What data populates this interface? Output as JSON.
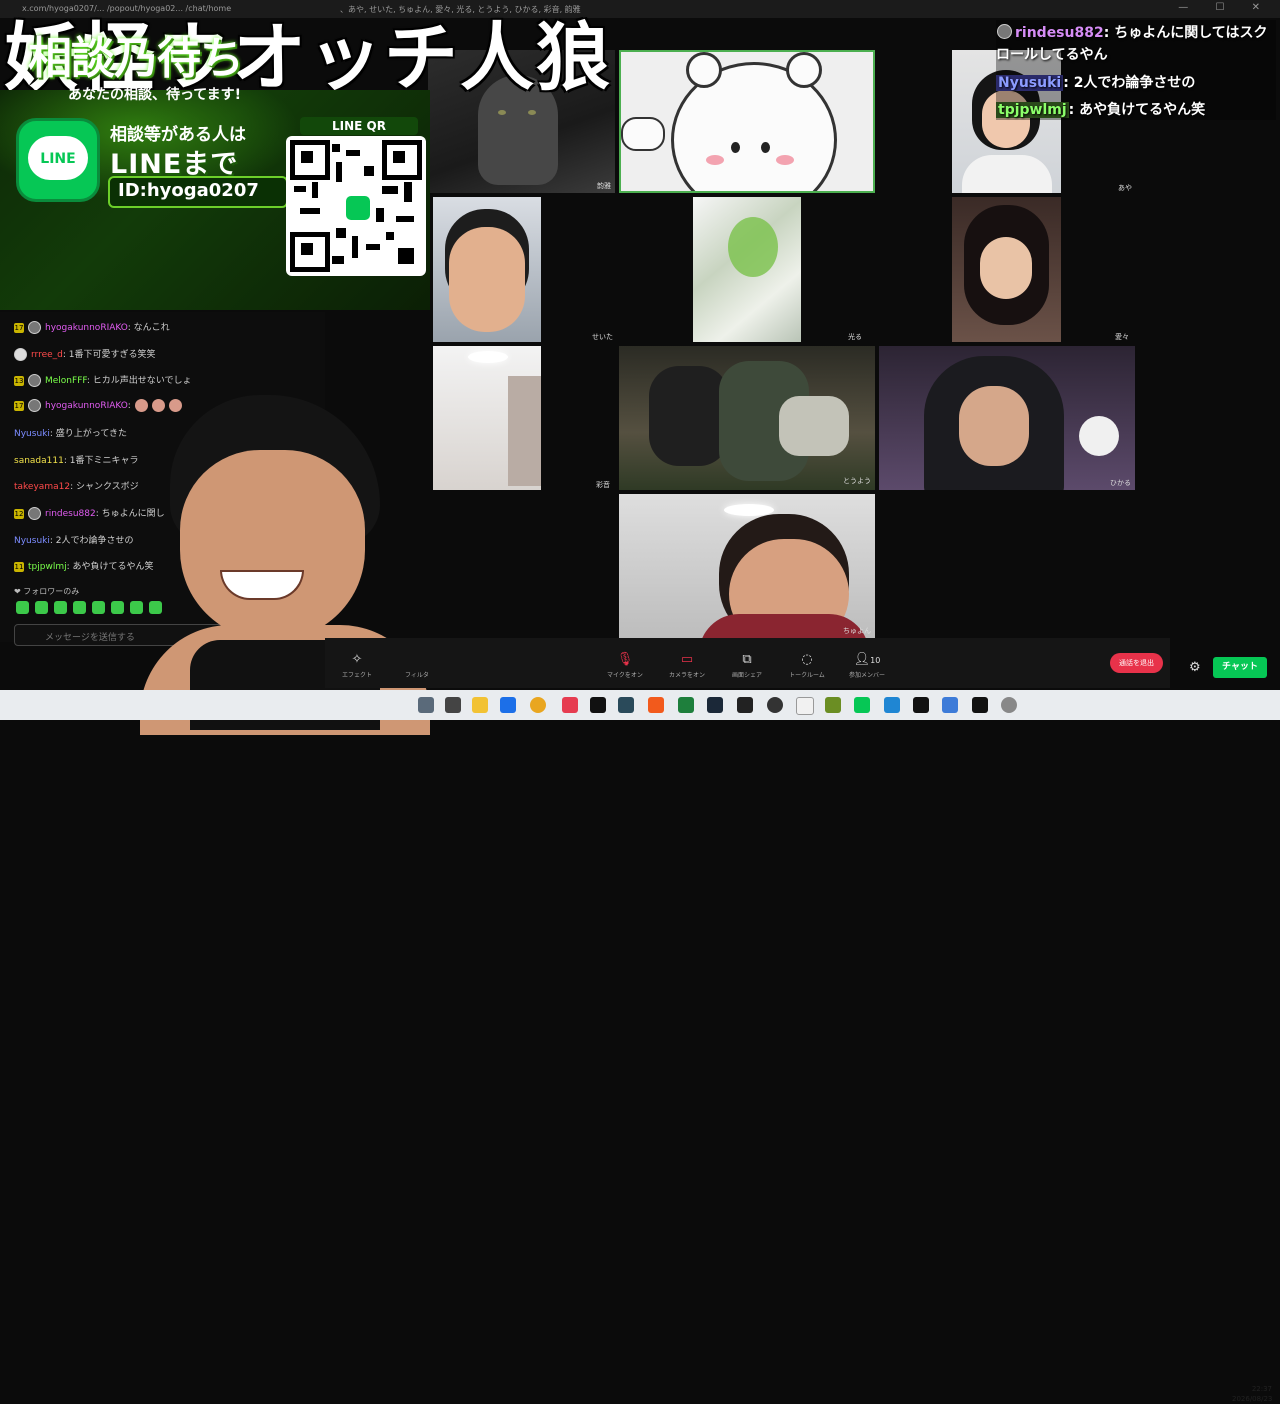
{
  "titlebar": {
    "url": "x.com/hyoga0207/... /popout/hyoga02... /chat/home",
    "participants": "、あや, せいた, ちゅよん, 愛々, 光る, とうよう, ひかる, 彩音, 韵雅",
    "window_controls": "— ☐ ✕"
  },
  "overlay_title": "妖怪ウオッチ人狼",
  "banner": {
    "title": "相談乃待ち",
    "subtitle": "あなたの相談、待ってます!",
    "line_icon_text": "LINE",
    "line_line1": "相談等がある人は",
    "line_line2": "LINEまで",
    "line_id": "ID:hyoga0207",
    "qr_label": "LINE QR"
  },
  "stream_chat": {
    "messages": [
      {
        "badge": "17",
        "user": "hyogakunnoRIAKO",
        "text": ": なんこれ",
        "user_color": "pink",
        "emotes": 0
      },
      {
        "badge": "",
        "user": "rrree_d",
        "text": ": 1番下可愛すぎる笑笑",
        "user_color": "red",
        "emotes": 0
      },
      {
        "badge": "13",
        "user": "MelonFFF",
        "text": ": ヒカル声出せないでしょ",
        "user_color": "green",
        "emotes": 0
      },
      {
        "badge": "17",
        "user": "hyogakunnoRIAKO",
        "text": ":",
        "user_color": "pink",
        "emotes": 3
      },
      {
        "badge": "",
        "user": "Nyusuki",
        "text": ": 盛り上がってきた",
        "user_color": "blue",
        "emotes": 0
      },
      {
        "badge": "",
        "user": "sanada111",
        "text": ": 1番下ミニキャラ",
        "user_color": "yellow",
        "emotes": 0
      },
      {
        "badge": "",
        "user": "takeyama12",
        "text": ": シャンクスボジ",
        "user_color": "red",
        "emotes": 0
      },
      {
        "badge": "12",
        "user": "rindesu882",
        "text": ": ちゅよんに関し",
        "user_color": "pink",
        "emotes": 0
      },
      {
        "badge": "",
        "user": "Nyusuki",
        "text": ": 2人でわ論争させの",
        "user_color": "blue",
        "emotes": 0
      },
      {
        "badge": "11",
        "user": "tpjpwlmj",
        "text": ": あや負けてるやん笑",
        "user_color": "green",
        "emotes": 0
      }
    ],
    "follower_only": "❤ フォロワーのみ",
    "input_placeholder": "メッセージを送信する"
  },
  "right_chat": [
    {
      "user": "rindesu882",
      "text": ": ちゅよんに関してはスク",
      "continuation": "ロールしてるやん",
      "user_color": "#d58cf5"
    },
    {
      "user": "Nyusuki",
      "text": ": 2人でわ論争させの",
      "continuation": "",
      "user_color": "#8c9cff"
    },
    {
      "user": "tpjpwlmj",
      "text": ": あや負けてるやん笑",
      "continuation": "",
      "user_color": "#8cff6a"
    }
  ],
  "video_tiles": [
    {
      "name": "韵雅",
      "subject": "cat"
    },
    {
      "name": "",
      "subject": "chiikawa"
    },
    {
      "name": "あや",
      "subject": "person"
    },
    {
      "name": "せいた",
      "subject": "person"
    },
    {
      "name": "光る",
      "subject": "blur"
    },
    {
      "name": "愛々",
      "subject": "person"
    },
    {
      "name": "彩音",
      "subject": "room"
    },
    {
      "name": "とうよう",
      "subject": "rugby"
    },
    {
      "name": "ひかる",
      "subject": "person-hood"
    },
    {
      "name": "ちゅよん",
      "subject": "person"
    }
  ],
  "toolbar": {
    "effect": "エフェクト",
    "filter": "フィルタ",
    "mic": "マイクをオン",
    "camera": "カメラをオン",
    "share": "画面シェア",
    "talk": "トークルーム",
    "members": "参加メンバー",
    "members_count": "10",
    "leave": "通話を退出",
    "chat": "チャット"
  },
  "clock": {
    "time": "22:37",
    "date": "2026/08/23"
  },
  "colors": {
    "line_green": "#06c755",
    "leave_red": "#e8324a"
  }
}
